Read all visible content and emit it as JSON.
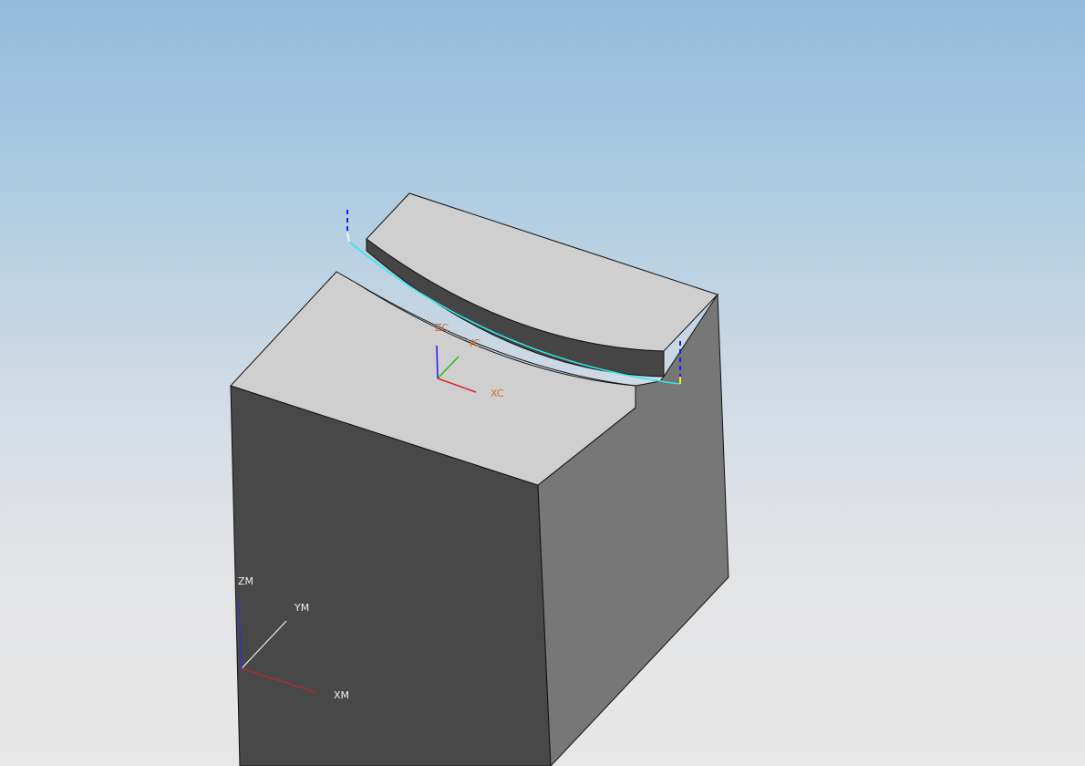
{
  "viewport": {
    "background_top": "#92bbdb",
    "background_bottom": "#e7e7e7"
  },
  "model": {
    "top_face_color": "#cfcfcf",
    "front_face_color": "#484848",
    "side_face_color": "#777777",
    "slot_wall_color": "#454545",
    "edge_color": "#111111"
  },
  "work_csys": {
    "x_label": "XC",
    "y_label": "YC",
    "z_label": "ZC",
    "x_color": "#e02020",
    "y_color": "#20c020",
    "z_color": "#1a1aff",
    "label_color": "#d86a1a"
  },
  "absolute_csys": {
    "x_label": "XM",
    "y_label": "YM",
    "z_label": "ZM",
    "label_color": "#f0f0f0"
  },
  "toolpath": {
    "cut_color": "#30e8e8",
    "engage_color": "#1a1aff",
    "marker_color": "#f0f000"
  }
}
